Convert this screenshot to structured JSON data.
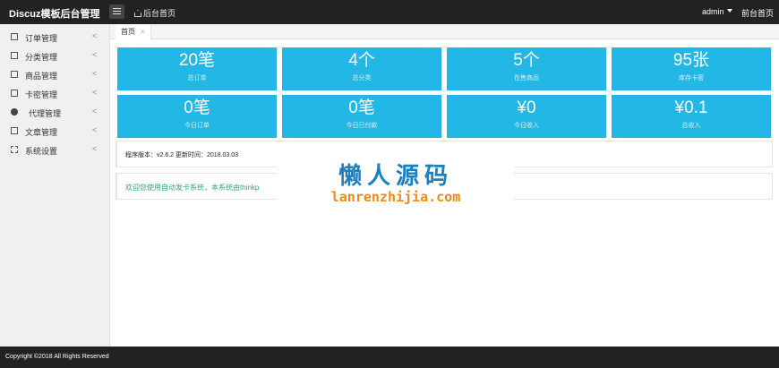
{
  "app": {
    "title": "Discuz模板后台管理"
  },
  "topbar": {
    "home_label": "后台首页",
    "user": "admin",
    "front_label": "前台首页"
  },
  "sidebar": {
    "items": [
      {
        "label": "订单管理",
        "icon": "archive-icon"
      },
      {
        "label": "分类管理",
        "icon": "list-icon"
      },
      {
        "label": "商品管理",
        "icon": "cube-icon"
      },
      {
        "label": "卡密管理",
        "icon": "card-icon"
      },
      {
        "label": "代理管理",
        "icon": "users-icon"
      },
      {
        "label": "文章管理",
        "icon": "file-icon"
      },
      {
        "label": "系统设置",
        "icon": "tools-icon"
      }
    ],
    "chevron": "<"
  },
  "tabs": [
    {
      "label": "首页",
      "close": "×"
    }
  ],
  "stats": [
    {
      "value": "20笔",
      "label": "总订单"
    },
    {
      "value": "4个",
      "label": "总分类"
    },
    {
      "value": "5个",
      "label": "在售商品"
    },
    {
      "value": "95张",
      "label": "库存卡密"
    },
    {
      "value": "0笔",
      "label": "今日订单"
    },
    {
      "value": "0笔",
      "label": "今日已付款"
    },
    {
      "value": "¥0",
      "label": "今日收入"
    },
    {
      "value": "¥0.1",
      "label": "总收入"
    }
  ],
  "info": {
    "version_text": "程序版本：v2.6.2  更新时间：2018.03.03"
  },
  "welcome": {
    "text": "欢迎您使用自动发卡系统，本系统由thinkp"
  },
  "watermark": {
    "title": "懒人源码",
    "subtitle": "lanrenzhijia.com"
  },
  "footer": {
    "copyright": "Copyright ©2018 All Rights Reserved"
  },
  "colors": {
    "accent": "#23b7e5",
    "topbar": "#222222",
    "sidebar": "#f0f0f0",
    "welcome_text": "#2aa580"
  }
}
